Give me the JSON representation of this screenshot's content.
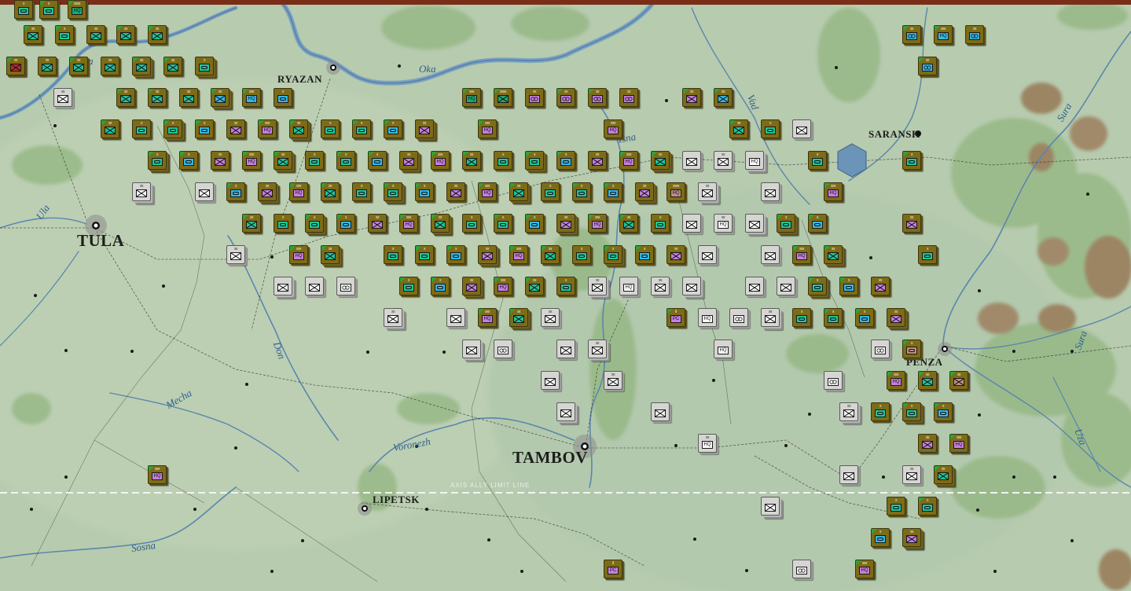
{
  "map": {
    "cities": [
      {
        "name": "RYAZAN",
        "style": "small"
      },
      {
        "name": "SARANSK",
        "style": "small"
      },
      {
        "name": "PENZA",
        "style": "small"
      },
      {
        "name": "LIPETSK",
        "style": "small"
      },
      {
        "name": "TULA",
        "style": "large"
      },
      {
        "name": "TAMBOV",
        "style": "large"
      }
    ],
    "rivers": [
      "Oka",
      "Oka",
      "Vad",
      "Tsna",
      "Sura",
      "Sura",
      "Ula",
      "Don",
      "Mecha",
      "Voronezh",
      "Sosna",
      "Uza"
    ],
    "limit_line_label": "AXIS ALLY LIMIT LINE"
  },
  "colors": {
    "soviet_counter": "#7d6c17",
    "axis_counter": "#d5d5d2",
    "infantry_cyan": "#35b8e6",
    "infantry_green": "#1ea774",
    "infantry_teal": "#22c49a",
    "infantry_violet": "#c77fe0",
    "infantry_purple": "#a28ae8",
    "infantry_pink": "#bd8f86",
    "hq_hex": "#6a94b8",
    "selected_red": "#c12a2a"
  },
  "counters": [
    {
      "side": "soviet",
      "color": "#22c49a",
      "type": "inf",
      "size": "xx",
      "stack": false
    },
    {
      "side": "soviet",
      "color": "#22c49a",
      "type": "inf",
      "size": "xx",
      "stack": false
    },
    {
      "side": "soviet",
      "color": "#1ea774",
      "type": "text",
      "label": "HQ",
      "size": "xxxx",
      "stack": false
    },
    {
      "side": "soviet",
      "color": "#22c49a",
      "type": "inf",
      "size": "xx",
      "stack": false
    },
    {
      "side": "soviet",
      "color": "#22c49a",
      "type": "inf",
      "size": "xx",
      "stack": false
    },
    {
      "side": "soviet",
      "color": "#22c49a",
      "type": "inf",
      "size": "xx",
      "stack": true
    },
    {
      "side": "soviet",
      "color": "#22c49a",
      "type": "inf",
      "size": "xx",
      "stack": false
    },
    {
      "side": "soviet",
      "color": "#22c49a",
      "type": "arm",
      "size": "x",
      "stack": true
    },
    {
      "side": "soviet",
      "color": "#22c49a",
      "type": "inf",
      "size": "xx",
      "stack": false
    },
    {
      "side": "soviet",
      "color": "#22c49a",
      "type": "arm",
      "size": "x",
      "stack": false
    },
    {
      "side": "soviet",
      "color": "#22c49a",
      "type": "inf",
      "size": "xx",
      "stack": false
    },
    {
      "side": "soviet",
      "color": "#22c49a",
      "type": "inf",
      "size": "xx",
      "stack": false
    },
    {
      "side": "soviet",
      "color": "#22c49a",
      "type": "inf",
      "size": "xx",
      "stack": false
    },
    {
      "side": "soviet",
      "color": "#22c49a",
      "type": "arm",
      "size": "x",
      "stack": false
    },
    {
      "side": "soviet",
      "color": "#22c49a",
      "type": "arm",
      "size": "x",
      "stack": false
    },
    {
      "side": "soviet",
      "color": "#35b8e6",
      "type": "arm",
      "size": "x",
      "stack": false
    },
    {
      "side": "axis",
      "color": "#ffffff",
      "type": "inf",
      "size": "xx",
      "stack": false
    },
    {
      "side": "soviet",
      "color": "#22c49a",
      "type": "inf",
      "size": "xx",
      "stack": false
    },
    {
      "side": "soviet",
      "color": "#22c49a",
      "type": "inf",
      "size": "xx",
      "stack": false
    },
    {
      "side": "soviet",
      "color": "#22c49a",
      "type": "inf",
      "size": "xx",
      "stack": false
    },
    {
      "side": "soviet",
      "color": "#35b8e6",
      "type": "inf",
      "size": "xx",
      "stack": true
    },
    {
      "side": "soviet",
      "color": "#35b8e6",
      "type": "text",
      "label": "HQ",
      "size": "xxx",
      "stack": false
    },
    {
      "side": "soviet",
      "color": "#35b8e6",
      "type": "arm",
      "size": "x",
      "stack": false
    },
    {
      "side": "soviet",
      "color": "#1ea774",
      "type": "text",
      "label": "HQ",
      "size": "xxx",
      "stack": false
    },
    {
      "side": "soviet",
      "color": "#1ea774",
      "type": "inf",
      "size": "xxxx",
      "stack": false
    },
    {
      "side": "soviet",
      "color": "#c77fe0",
      "type": "recon",
      "size": "xx",
      "stack": false
    },
    {
      "side": "soviet",
      "color": "#c77fe0",
      "type": "recon",
      "size": "xx",
      "stack": false
    },
    {
      "side": "soviet",
      "color": "#c77fe0",
      "type": "recon",
      "size": "xx",
      "stack": false
    },
    {
      "side": "soviet",
      "color": "#c77fe0",
      "type": "recon",
      "size": "xx",
      "stack": false
    },
    {
      "side": "soviet",
      "color": "#c77fe0",
      "type": "inf",
      "size": "xx",
      "stack": false
    },
    {
      "side": "soviet",
      "color": "#35b8e6",
      "type": "inf",
      "size": "xx",
      "stack": false
    },
    {
      "side": "soviet",
      "color": "#c77fe0",
      "type": "text",
      "label": "HQ",
      "size": "xxx",
      "stack": false
    },
    {
      "side": "soviet",
      "color": "#35b8e6",
      "type": "recon",
      "size": "xx",
      "stack": false
    },
    {
      "side": "soviet",
      "color": "#35b8e6",
      "type": "text",
      "label": "HQ",
      "size": "xxx",
      "stack": false
    },
    {
      "side": "soviet",
      "color": "#35b8e6",
      "type": "recon",
      "size": "xx",
      "stack": false
    },
    {
      "side": "soviet",
      "color": "#35b8e6",
      "type": "recon",
      "size": "xx",
      "stack": false
    },
    {
      "side": "soviet",
      "color": "#c77fe0",
      "type": "text",
      "label": "HQ",
      "size": "xxx",
      "stack": false
    },
    {
      "side": "soviet",
      "color": "#c77fe0",
      "type": "text",
      "label": "PC",
      "size": "II",
      "stack": false
    },
    {
      "side": "soviet",
      "color": "#c77fe0",
      "type": "text",
      "label": "PC",
      "size": "II",
      "stack": false
    },
    {
      "side": "axis",
      "color": "#ffffff",
      "type": "text",
      "label": "HQ",
      "size": "",
      "stack": false
    },
    {
      "side": "axis",
      "color": "#ffffff",
      "type": "text",
      "label": "HQ",
      "size": "xx",
      "stack": false
    },
    {
      "side": "axis",
      "color": "#ffffff",
      "type": "text",
      "label": "HQ",
      "size": "",
      "stack": false
    },
    {
      "side": "axis",
      "color": "#ffffff",
      "type": "recon",
      "size": "",
      "stack": false
    },
    {
      "side": "axis",
      "color": "#ffffff",
      "type": "recon",
      "size": "",
      "stack": false
    },
    {
      "side": "soviet",
      "color": "#bd8f86",
      "type": "arm",
      "size": "x",
      "stack": false
    },
    {
      "side": "soviet",
      "color": "#bd8f86",
      "type": "inf",
      "size": "xx",
      "stack": false
    },
    {
      "side": "soviet",
      "color": "#bd8f86",
      "type": "text",
      "label": "HQ",
      "size": "xxxx",
      "stack": false
    },
    {
      "side": "soviet",
      "color": "#c12a2a",
      "type": "inf",
      "size": "xx",
      "stack": false
    }
  ]
}
